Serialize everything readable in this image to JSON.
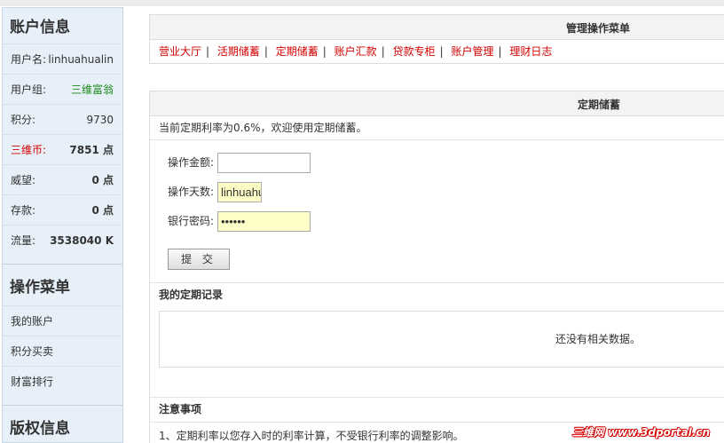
{
  "sidebar": {
    "account_title": "账户信息",
    "rows": [
      {
        "label": "用户名:",
        "value": "linhuahualin"
      },
      {
        "label": "用户组:",
        "value": "三维富翁"
      },
      {
        "label": "积分:",
        "value": "9730"
      },
      {
        "label": "三维币:",
        "value": "7851 点"
      },
      {
        "label": "威望:",
        "value": "0 点"
      },
      {
        "label": "存款:",
        "value": "0 点"
      },
      {
        "label": "流量:",
        "value": "3538040 K"
      }
    ],
    "menu_title": "操作菜单",
    "menu_items": [
      "我的账户",
      "积分买卖",
      "财富排行"
    ],
    "copyright_title": "版权信息"
  },
  "nav": {
    "title": "管理操作菜单",
    "links": [
      "营业大厅",
      "活期储蓄",
      "定期储蓄",
      "账户汇款",
      "贷款专柜",
      "账户管理",
      "理财日志"
    ]
  },
  "deposit": {
    "title": "定期储蓄",
    "rate_text": "当前定期利率为0.6%，欢迎使用定期储蓄。",
    "amount_label": "操作金额:",
    "amount_value": "",
    "days_label": "操作天数:",
    "days_value": "linhuahualin",
    "password_label": "银行密码:",
    "password_value": "••••••",
    "submit_label": "提 交"
  },
  "records": {
    "title": "我的定期记录",
    "empty_text": "还没有相关数据。"
  },
  "notes": {
    "title": "注意事项",
    "items": [
      "1、定期利率以您存入时的利率计算，不受银行利率的调整影响。"
    ]
  },
  "watermark": "三维网 www.3dportal.cn",
  "colors": {
    "link_red": "#d40000",
    "group_green": "#1a8a1a",
    "sidebar_bg": "#e7f0f8",
    "input_yellow": "#fdfdc8"
  }
}
